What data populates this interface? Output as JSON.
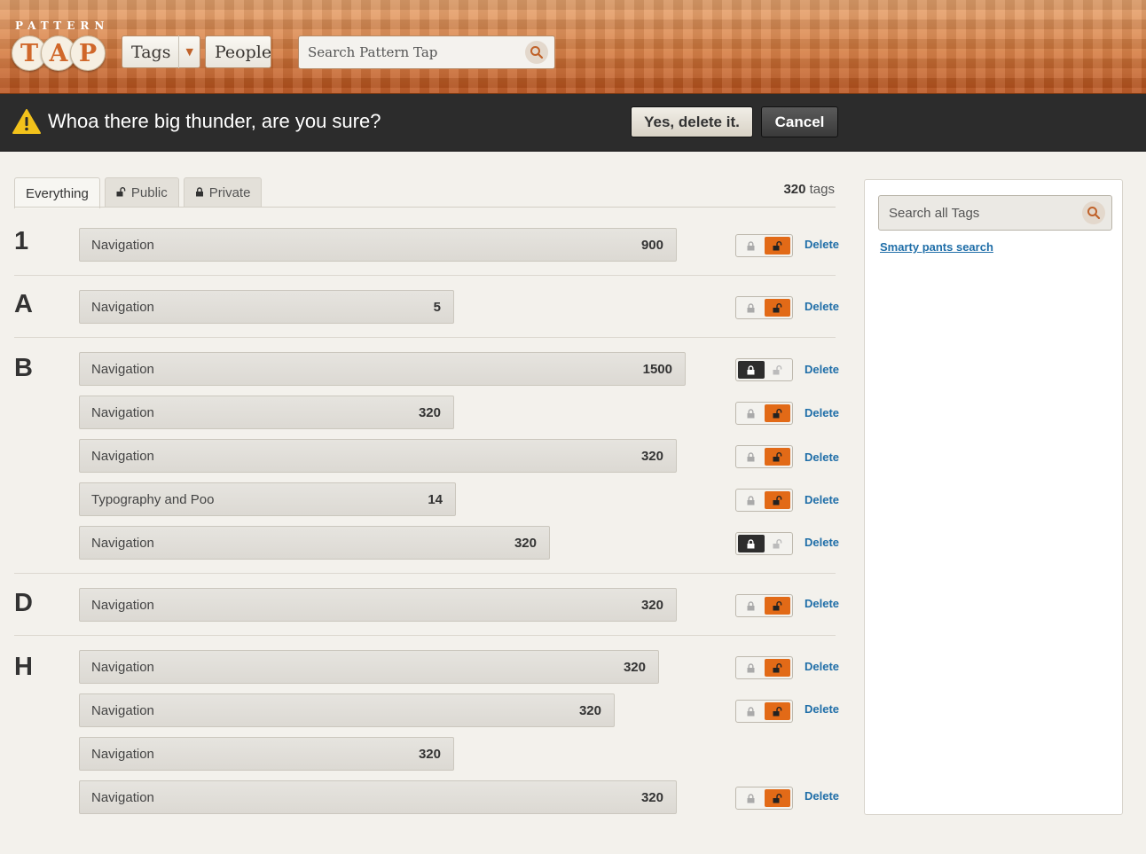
{
  "header": {
    "logo_small": "PATTERN",
    "logo_letters": [
      "T",
      "A",
      "P"
    ],
    "nav": {
      "tags_label": "Tags",
      "caret": "▼",
      "people_label": "People"
    },
    "search": {
      "placeholder": "Search Pattern Tap"
    }
  },
  "alert": {
    "message": "Whoa there big thunder, are you sure?",
    "confirm_label": "Yes, delete it.",
    "cancel_label": "Cancel"
  },
  "tabs": [
    {
      "label": "Everything",
      "active": true
    },
    {
      "label": "Public",
      "icon": "unlocked-icon"
    },
    {
      "label": "Private",
      "icon": "lock-icon"
    }
  ],
  "tag_count": {
    "number": "320",
    "unit": "tags"
  },
  "sections": [
    {
      "letter": "1",
      "rows": [
        {
          "name": "Navigation",
          "count": "900",
          "access": "public",
          "delete": "Delete"
        }
      ]
    },
    {
      "letter": "A",
      "rows": [
        {
          "name": "Navigation",
          "count": "5",
          "access": "public",
          "delete": "Delete"
        }
      ]
    },
    {
      "letter": "B",
      "rows": [
        {
          "name": "Navigation",
          "count": "1500",
          "access": "private",
          "delete": "Delete"
        },
        {
          "name": "Navigation",
          "count": "320",
          "access": "public",
          "delete": "Delete"
        },
        {
          "name": "Navigation",
          "count": "320",
          "access": "public",
          "delete": "Delete"
        },
        {
          "name": "Typography and Poo",
          "count": "14",
          "access": "public",
          "delete": "Delete"
        },
        {
          "name": "Navigation",
          "count": "320",
          "access": "private",
          "delete": "Delete"
        }
      ]
    },
    {
      "letter": "D",
      "rows": [
        {
          "name": "Navigation",
          "count": "320",
          "access": "public",
          "delete": "Delete"
        }
      ]
    },
    {
      "letter": "H",
      "rows": [
        {
          "name": "Navigation",
          "count": "320",
          "access": "public",
          "delete": "Delete"
        },
        {
          "name": "Navigation",
          "count": "320",
          "access": "public",
          "delete": "Delete"
        },
        {
          "name": "Navigation",
          "count": "320"
        },
        {
          "name": "Navigation",
          "count": "320",
          "access": "public",
          "delete": "Delete"
        }
      ]
    }
  ],
  "sidebar": {
    "search_placeholder": "Search all Tags",
    "link": "Smarty pants search"
  },
  "colors": {
    "accent_orange": "#e26a17",
    "link_blue": "#1f6ea8",
    "alert_bg": "#2c2c2c"
  }
}
